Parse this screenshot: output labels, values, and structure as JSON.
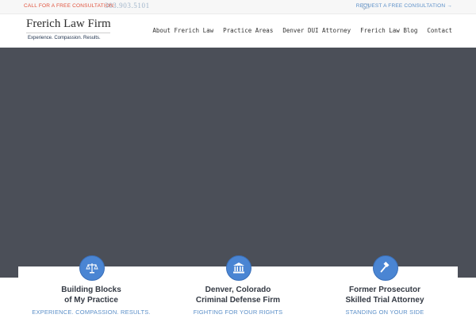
{
  "topbar": {
    "call_label": "CALL FOR A FREE CONSULTATION:",
    "phone": "303.903.5101",
    "request_label": "REQUEST A FREE CONSULTATION →"
  },
  "logo": {
    "title": "Frerich Law Firm",
    "tagline": "Experience. Compassion. Results."
  },
  "nav": {
    "items": [
      "About Frerich Law",
      "Practice Areas",
      "Denver DUI Attorney",
      "Frerich Law Blog",
      "Contact"
    ]
  },
  "cards": [
    {
      "icon": "scales-icon",
      "title_line1": "Building Blocks",
      "title_line2": "of My Practice",
      "subtitle": "EXPERIENCE. COMPASSION. RESULTS."
    },
    {
      "icon": "courthouse-icon",
      "title_line1": "Denver, Colorado",
      "title_line2": "Criminal Defense Firm",
      "subtitle": "FIGHTING FOR YOUR RIGHTS"
    },
    {
      "icon": "gavel-icon",
      "title_line1": "Former Prosecutor",
      "title_line2": "Skilled Trial Attorney",
      "subtitle": "STANDING ON YOUR SIDE"
    }
  ],
  "colors": {
    "accent_blue": "#4a85d3",
    "hero_bg": "#4b4f58",
    "call_red": "#e0523c"
  }
}
